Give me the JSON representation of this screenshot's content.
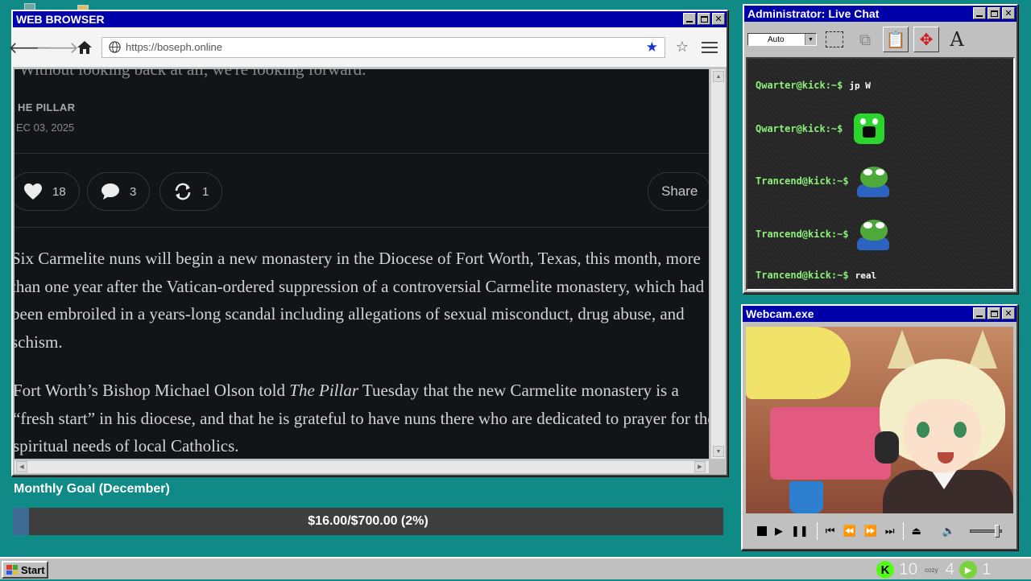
{
  "browser": {
    "title": "WEB BROWSER",
    "url": "https://boseph.online",
    "article": {
      "faded_line": "Without looking back at all, we're looking forward.",
      "byline": "HE PILLAR",
      "date": "EC 03, 2025",
      "likes": "18",
      "comments": "3",
      "restacks": "1",
      "share_label": "Share",
      "para1": "Six Carmelite nuns will begin a new monastery in the Diocese of Fort Worth, Texas, this month, more than one year after the Vatican-ordered suppression of a controversial Carmelite monastery, which had been embroiled in a years-long scandal including allegations of sexual misconduct, drug abuse, and schism.",
      "para2_a": "Fort Worth’s Bishop Michael Olson told ",
      "para2_em": "The Pillar",
      "para2_b": " Tuesday that the new Carmelite monastery is a “fresh start” in his diocese, and that he is grateful to have nuns there who are dedicated to prayer for the spiritual needs of local Catholics."
    }
  },
  "goal": {
    "label": "Monthly Goal (December)",
    "text": "$16.00/$700.00 (2%)",
    "progress": 0.023
  },
  "chat": {
    "title": "Administrator: Live Chat",
    "font_select": "Auto",
    "font_tool": "A",
    "messages": [
      {
        "user": "Qwarter@kick:~$",
        "text": "jp W"
      },
      {
        "user": "Qwarter@kick:~$",
        "emote": "green-ghost-emote"
      },
      {
        "user": "Trancend@kick:~$",
        "emote": "pepe-frog-emote"
      },
      {
        "user": "Trancend@kick:~$",
        "emote": "pepe-frog-emote"
      },
      {
        "user": "Trancend@kick:~$",
        "text": "real"
      }
    ]
  },
  "webcam": {
    "title": "Webcam.exe"
  },
  "taskbar": {
    "start_label": "Start",
    "kick_count": "10",
    "cozy_label": "cozy",
    "cozy_count": "4",
    "other_count": "1"
  },
  "colors": {
    "desktop": "#0f8a86",
    "titlebar": "#0000a8",
    "chat_user": "#8cf07a",
    "goal_fill": "#3e6a95",
    "kick_green": "#53fc18"
  }
}
